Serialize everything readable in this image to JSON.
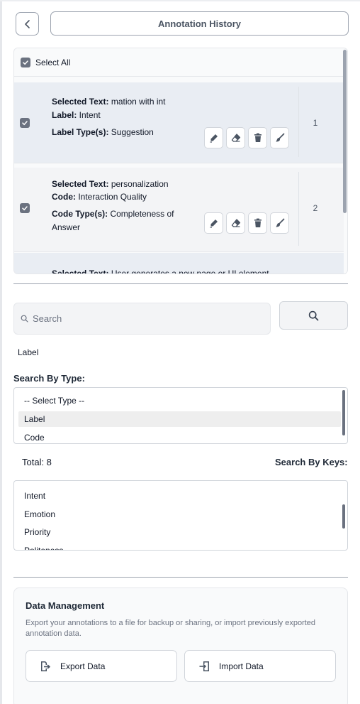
{
  "header": {
    "back_label": "<",
    "title": "Annotation History"
  },
  "annotation_list": {
    "select_all_label": "Select All",
    "select_all_checked": true,
    "items": [
      {
        "index": "1",
        "checked": true,
        "line1_key": "Selected Text:",
        "line1_val": " mation with int",
        "line2_key": "Label:",
        "line2_val": " Intent",
        "line3_key": "Label Type(s):",
        "line3_val": " Suggestion",
        "actions": [
          "pen-icon",
          "eraser-icon",
          "trash-icon",
          "brush-icon"
        ]
      },
      {
        "index": "2",
        "checked": true,
        "line1_key": "Selected Text:",
        "line1_val": " personalization",
        "line2_key": "Code:",
        "line2_val": " Interaction Quality",
        "line3_key": "Code Type(s):",
        "line3_val": " Completeness of",
        "line4_val": "Answer",
        "actions": [
          "pen-icon",
          "eraser-icon",
          "trash-icon",
          "brush-icon"
        ]
      },
      {
        "line1_key": "Selected Text:",
        "line1_val": " User generates a new page or UI element"
      }
    ]
  },
  "search": {
    "placeholder": "Search",
    "current_value": "",
    "button_icon": "search-icon"
  },
  "current_filter_label": "Label",
  "search_by_type": {
    "heading": "Search By Type:",
    "options": [
      "-- Select Type --",
      "Label",
      "Code"
    ],
    "selected": "Label"
  },
  "total_label": "Total: 8",
  "search_by_keys": {
    "heading": "Search By Keys:",
    "options": [
      "Intent",
      "Emotion",
      "Priority",
      "Politeness"
    ]
  },
  "data_management": {
    "title": "Data Management",
    "description": "Export your annotations to a file for backup or sharing, or import previously exported annotation data.",
    "export_label": "Export Data",
    "import_label": "Import Data"
  }
}
